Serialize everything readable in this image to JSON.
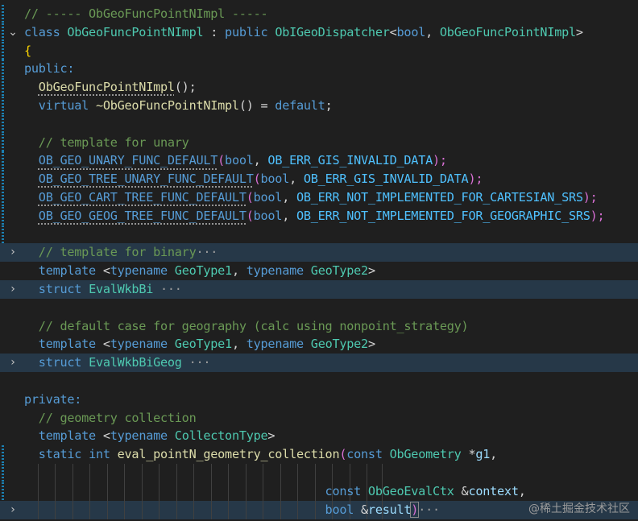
{
  "editor": {
    "lines": [
      {
        "tokens": [
          [
            "// ----- ObGeoFuncPointNImpl -----",
            "comment"
          ]
        ],
        "mod": true
      },
      {
        "tokens": [
          [
            "class ",
            "kw"
          ],
          [
            "ObGeoFuncPointNImpl",
            "type"
          ],
          [
            " : ",
            "plain"
          ],
          [
            "public ",
            "kw"
          ],
          [
            "ObIGeoDispatcher",
            "type"
          ],
          [
            "<",
            "plain"
          ],
          [
            "bool",
            "kw"
          ],
          [
            ", ",
            "plain"
          ],
          [
            "ObGeoFuncPointNImpl",
            "type"
          ],
          [
            ">",
            "plain"
          ]
        ],
        "mod": true,
        "fold": "open"
      },
      {
        "tokens": [
          [
            "{",
            "brk1"
          ]
        ],
        "mod": true
      },
      {
        "tokens": [
          [
            "public:",
            "kw"
          ]
        ],
        "mod": true
      },
      {
        "tokens": [
          [
            "  ",
            "plain"
          ],
          [
            "ObGeoFuncPointNImpl",
            "fn squig"
          ],
          [
            "();",
            "plain"
          ]
        ],
        "mod": true
      },
      {
        "tokens": [
          [
            "  ",
            "plain"
          ],
          [
            "virtual ",
            "kw"
          ],
          [
            "~ObGeoFuncPointNImpl",
            "fn"
          ],
          [
            "() = ",
            "plain"
          ],
          [
            "default",
            "kw"
          ],
          [
            ";",
            "plain"
          ]
        ],
        "mod": true
      },
      {
        "tokens": [],
        "mod": true
      },
      {
        "tokens": [
          [
            "  ",
            "plain"
          ],
          [
            "// template for unary",
            "comment"
          ]
        ],
        "mod": true
      },
      {
        "tokens": [
          [
            "  ",
            "plain"
          ],
          [
            "OB_GEO_UNARY_FUNC_DEFAULT",
            "macro2 squig"
          ],
          [
            "(",
            "brk2"
          ],
          [
            "bool",
            "kw"
          ],
          [
            ", ",
            "plain"
          ],
          [
            "OB_ERR_GIS_INVALID_DATA",
            "macro"
          ],
          [
            ");",
            "brk2"
          ]
        ],
        "mod": true
      },
      {
        "tokens": [
          [
            "  ",
            "plain"
          ],
          [
            "OB_GEO_TREE_UNARY_FUNC_DEFAULT",
            "macro2 squig"
          ],
          [
            "(",
            "brk2"
          ],
          [
            "bool",
            "kw"
          ],
          [
            ", ",
            "plain"
          ],
          [
            "OB_ERR_GIS_INVALID_DATA",
            "macro"
          ],
          [
            ");",
            "brk2"
          ]
        ],
        "mod": true
      },
      {
        "tokens": [
          [
            "  ",
            "plain"
          ],
          [
            "OB_GEO_CART_TREE_FUNC_DEFAULT",
            "macro2 squig"
          ],
          [
            "(",
            "brk2"
          ],
          [
            "bool",
            "kw"
          ],
          [
            ", ",
            "plain"
          ],
          [
            "OB_ERR_NOT_IMPLEMENTED_FOR_CARTESIAN_SRS",
            "macro"
          ],
          [
            ");",
            "brk2"
          ]
        ],
        "mod": true
      },
      {
        "tokens": [
          [
            "  ",
            "plain"
          ],
          [
            "OB_GEO_GEOG_TREE_FUNC_DEFAULT",
            "macro2 squig"
          ],
          [
            "(",
            "brk2"
          ],
          [
            "bool",
            "kw"
          ],
          [
            ", ",
            "plain"
          ],
          [
            "OB_ERR_NOT_IMPLEMENTED_FOR_GEOGRAPHIC_SRS",
            "macro"
          ],
          [
            ");",
            "brk2"
          ]
        ],
        "mod": true
      },
      {
        "tokens": [],
        "mod": true
      },
      {
        "tokens": [
          [
            "  ",
            "plain"
          ],
          [
            "// template for binary",
            "comment"
          ],
          [
            "···",
            "ellipsis"
          ]
        ],
        "fold": "closed",
        "hl": true
      },
      {
        "tokens": [
          [
            "  ",
            "plain"
          ],
          [
            "template ",
            "kw"
          ],
          [
            "<",
            "plain"
          ],
          [
            "typename ",
            "kw"
          ],
          [
            "GeoType1",
            "type"
          ],
          [
            ", ",
            "plain"
          ],
          [
            "typename ",
            "kw"
          ],
          [
            "GeoType2",
            "type"
          ],
          [
            ">",
            "plain"
          ]
        ]
      },
      {
        "tokens": [
          [
            "  ",
            "plain"
          ],
          [
            "struct ",
            "kw"
          ],
          [
            "EvalWkbBi",
            "type"
          ],
          [
            " ···",
            "ellipsis"
          ]
        ],
        "fold": "closed",
        "hl": true
      },
      {
        "tokens": []
      },
      {
        "tokens": [
          [
            "  ",
            "plain"
          ],
          [
            "// default case for geography (calc using nonpoint_strategy)",
            "comment"
          ]
        ]
      },
      {
        "tokens": [
          [
            "  ",
            "plain"
          ],
          [
            "template ",
            "kw"
          ],
          [
            "<",
            "plain"
          ],
          [
            "typename ",
            "kw"
          ],
          [
            "GeoType1",
            "type"
          ],
          [
            ", ",
            "plain"
          ],
          [
            "typename ",
            "kw"
          ],
          [
            "GeoType2",
            "type"
          ],
          [
            ">",
            "plain"
          ]
        ]
      },
      {
        "tokens": [
          [
            "  ",
            "plain"
          ],
          [
            "struct ",
            "kw"
          ],
          [
            "EvalWkbBiGeog",
            "type"
          ],
          [
            " ···",
            "ellipsis"
          ]
        ],
        "fold": "closed",
        "hl": true
      },
      {
        "tokens": []
      },
      {
        "tokens": [
          [
            "private:",
            "kw"
          ]
        ]
      },
      {
        "tokens": [
          [
            "  ",
            "plain"
          ],
          [
            "// geometry collection",
            "comment"
          ]
        ]
      },
      {
        "tokens": [
          [
            "  ",
            "plain"
          ],
          [
            "template ",
            "kw"
          ],
          [
            "<",
            "plain"
          ],
          [
            "typename ",
            "kw"
          ],
          [
            "CollectonType",
            "type"
          ],
          [
            ">",
            "plain"
          ]
        ]
      },
      {
        "tokens": [
          [
            "  ",
            "plain"
          ],
          [
            "static ",
            "kw"
          ],
          [
            "int ",
            "kw"
          ],
          [
            "eval_pointN_geometry_collection",
            "fn"
          ],
          [
            "(",
            "brk2"
          ],
          [
            "const ",
            "kw"
          ],
          [
            "ObGeometry ",
            "type"
          ],
          [
            "*",
            "plain"
          ],
          [
            "g1",
            "var"
          ],
          [
            ",",
            "plain"
          ]
        ],
        "mod": true
      },
      {
        "tokens": [],
        "mod": true,
        "guides": true
      },
      {
        "tokens": [
          [
            "                                          ",
            "plain"
          ],
          [
            "const ",
            "kw"
          ],
          [
            "ObGeoEvalCtx ",
            "type"
          ],
          [
            "&",
            "plain"
          ],
          [
            "context",
            "var"
          ],
          [
            ",",
            "plain"
          ]
        ],
        "mod": true,
        "guides": true
      },
      {
        "tokens": [
          [
            "                                          ",
            "plain"
          ],
          [
            "bool ",
            "kw"
          ],
          [
            "&",
            "plain"
          ],
          [
            "result",
            "var"
          ],
          [
            ")",
            "brk2 cursor-box"
          ],
          [
            "···",
            "ellipsis"
          ]
        ],
        "fold": "closed",
        "hl": true,
        "guides": true
      }
    ]
  },
  "watermark": "@稀土掘金技术社区"
}
